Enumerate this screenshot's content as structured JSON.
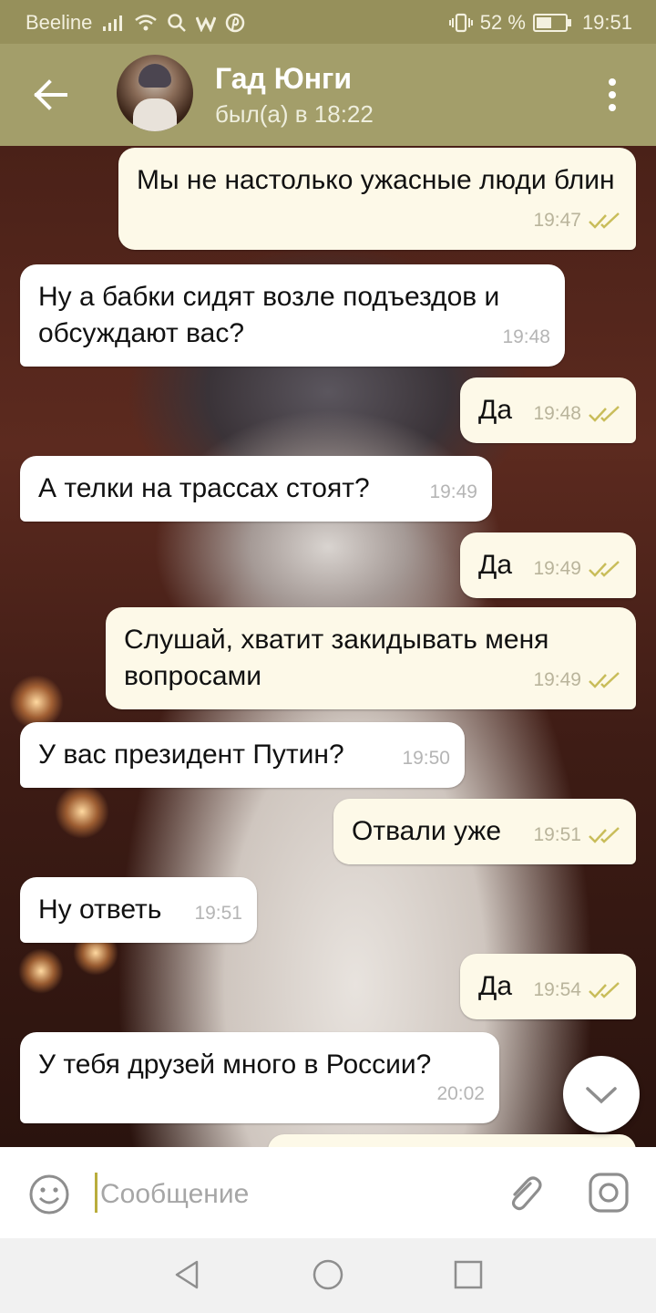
{
  "status_bar": {
    "carrier": "Beeline",
    "battery": "52 %",
    "battery_level": 0.52,
    "time": "19:51",
    "icons": [
      "signal-icon",
      "wifi-icon",
      "search-icon",
      "w-app-icon",
      "pinterest-icon",
      "vibrate-icon",
      "battery-icon"
    ]
  },
  "header": {
    "contact_name": "Гад Юнги",
    "contact_status": "был(а) в 18:22",
    "icons": [
      "back-arrow-icon",
      "avatar",
      "more-vert-icon"
    ]
  },
  "messages": [
    {
      "direction": "out",
      "text": "Мы не настолько ужасные люди блин",
      "time": "19:47",
      "read": true
    },
    {
      "direction": "in",
      "text": "Ну а бабки сидят возле подъездов и обсуждают вас?",
      "time": "19:48"
    },
    {
      "direction": "out",
      "text": "Да",
      "time": "19:48",
      "read": true
    },
    {
      "direction": "in",
      "text": "А телки на трассах стоят?",
      "time": "19:49"
    },
    {
      "direction": "out",
      "text": "Да",
      "time": "19:49",
      "read": true
    },
    {
      "direction": "out",
      "text": "Слушай, хватит закидывать меня вопросами",
      "time": "19:49",
      "read": true
    },
    {
      "direction": "in",
      "text": "У вас президент Путин?",
      "time": "19:50"
    },
    {
      "direction": "out",
      "text": "Отвали уже",
      "time": "19:51",
      "read": true
    },
    {
      "direction": "in",
      "text": "Ну ответь",
      "time": "19:51"
    },
    {
      "direction": "out",
      "text": "Да",
      "time": "19:54",
      "read": true
    },
    {
      "direction": "in",
      "text": "У тебя друзей много в России?",
      "time": "20:02"
    }
  ],
  "input": {
    "placeholder": "Сообщение",
    "value": ""
  },
  "colors": {
    "status_bar": "#96905b",
    "header": "#a39e6a",
    "outgoing_bubble": "#fdf9e8",
    "incoming_bubble": "#ffffff",
    "read_ticks": "#c9bd5a",
    "cursor": "#b9ad3c"
  }
}
